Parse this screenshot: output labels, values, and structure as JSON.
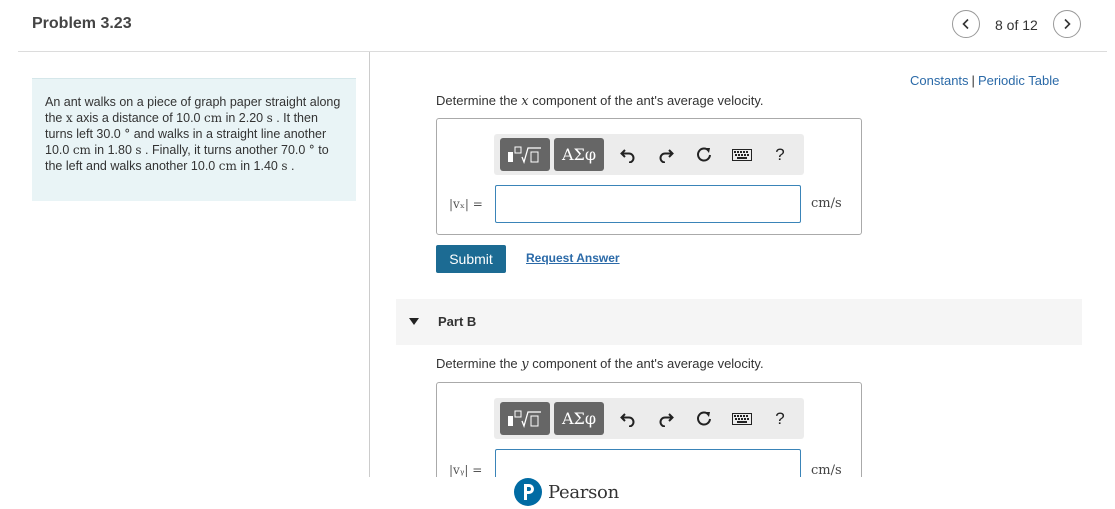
{
  "header": {
    "title": "Problem 3.23",
    "page_indicator": "8 of 12",
    "prev_icon": "chevron-left-icon",
    "next_icon": "chevron-right-icon"
  },
  "problem": {
    "segments": [
      {
        "t": "An ant walks on a piece of graph paper straight along the "
      },
      {
        "m": "x"
      },
      {
        "t": " axis a distance of 10.0 "
      },
      {
        "m": "cm"
      },
      {
        "t": " in 2.20 "
      },
      {
        "m": "s"
      },
      {
        "t": " . It then turns left 30.0 "
      },
      {
        "m": "°"
      },
      {
        "t": " and walks in a straight line another 10.0 "
      },
      {
        "m": "cm"
      },
      {
        "t": " in 1.80 "
      },
      {
        "m": "s"
      },
      {
        "t": " . Finally, it turns another 70.0 "
      },
      {
        "m": "°"
      },
      {
        "t": " to the left and walks another 10.0 "
      },
      {
        "m": "cm"
      },
      {
        "t": " in 1.40 "
      },
      {
        "m": "s"
      },
      {
        "t": " ."
      }
    ]
  },
  "links": {
    "constants": "Constants",
    "separator": "|",
    "periodic_table": "Periodic Table"
  },
  "part_a": {
    "question_prefix": "Determine the ",
    "question_var": "x",
    "question_suffix": " component of the ant's average velocity.",
    "var_label": "|vₓ| =",
    "input_value": "",
    "unit": "cm/s",
    "submit_label": "Submit",
    "request_label": "Request Answer"
  },
  "toolbar": {
    "templates_icon": "templates-icon",
    "symbols_label": "ΑΣφ",
    "undo_icon": "undo-icon",
    "redo_icon": "redo-icon",
    "reset_icon": "reset-icon",
    "keyboard_icon": "keyboard-icon",
    "help_label": "?"
  },
  "part_b": {
    "title": "Part B",
    "question_prefix": "Determine the ",
    "question_var": "y",
    "question_suffix": " component of the ant's average velocity.",
    "var_label": "|vᵧ| =",
    "input_value": "",
    "unit": "cm/s"
  },
  "footer": {
    "brand": "Pearson"
  }
}
